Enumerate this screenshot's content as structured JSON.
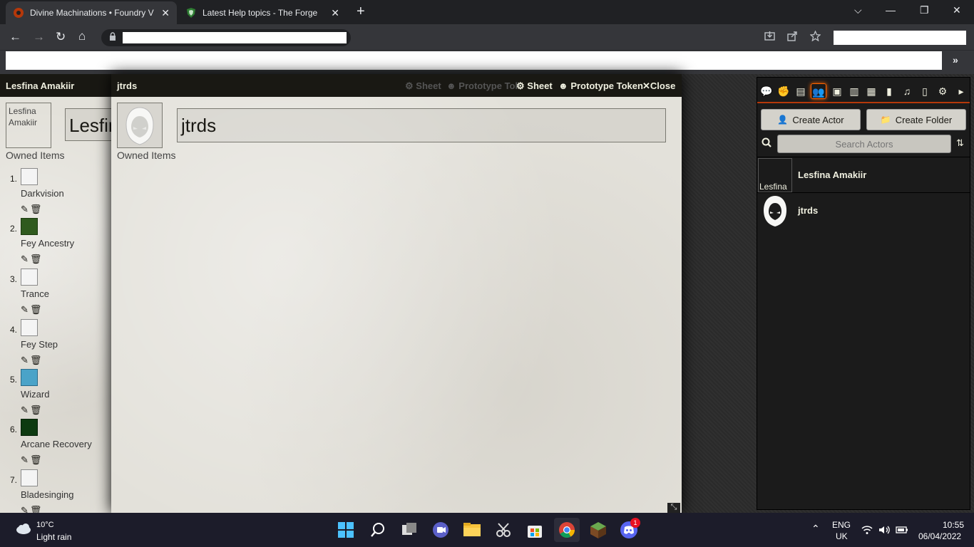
{
  "browser": {
    "tabs": [
      {
        "title": "Divine Machinations • Foundry V",
        "active": true
      },
      {
        "title": "Latest Help topics - The Forge",
        "active": false
      }
    ],
    "new_tab": "+",
    "window_controls": {
      "dropdown": "⌵",
      "minimize": "—",
      "restore": "❐",
      "close": "✕"
    }
  },
  "nav": {
    "back": "←",
    "forward": "→",
    "reload": "↻",
    "home": "⌂",
    "bookmarks_more": "»"
  },
  "lesfina_window": {
    "title": "Lesfina Amakiir",
    "portrait_alt": "Lesfina Amakiir",
    "name_value": "Lesfina Amakiir",
    "owned_label": "Owned Items",
    "items": [
      {
        "num": "1.",
        "name": "Darkvision"
      },
      {
        "num": "2.",
        "name": "Fey Ancestry"
      },
      {
        "num": "3.",
        "name": "Trance"
      },
      {
        "num": "4.",
        "name": "Fey Step"
      },
      {
        "num": "5.",
        "name": "Wizard"
      },
      {
        "num": "6.",
        "name": "Arcane Recovery"
      },
      {
        "num": "7.",
        "name": "Bladesinging"
      }
    ]
  },
  "jtrds_window": {
    "title": "jtrds",
    "ghost_sheet": "Sheet",
    "ghost_prototype": "Prototype Tok",
    "sheet_label": "Sheet",
    "prototype_label": "Prototype Token",
    "close_label": "Close",
    "name_value": "jtrds",
    "owned_label": "Owned Items"
  },
  "sidebar": {
    "create_actor": "Create Actor",
    "create_folder": "Create Folder",
    "search_placeholder": "Search Actors",
    "actors": [
      {
        "name": "Lesfina Amakiir",
        "thumb_alt": "Lesfina"
      },
      {
        "name": "jtrds"
      }
    ]
  },
  "taskbar": {
    "weather_temp": "10°C",
    "weather_desc": "Light rain",
    "discord_badge": "1",
    "lang_1": "ENG",
    "lang_2": "UK",
    "time": "10:55",
    "date": "06/04/2022"
  },
  "colors": {
    "chrome_dark": "#202124",
    "chrome_tab": "#35363a",
    "foundry_header": "#191813",
    "sidebar_accent": "#b5380a",
    "sheet_parchment": "#e3e1da",
    "taskbar": "#1c1c2a"
  }
}
